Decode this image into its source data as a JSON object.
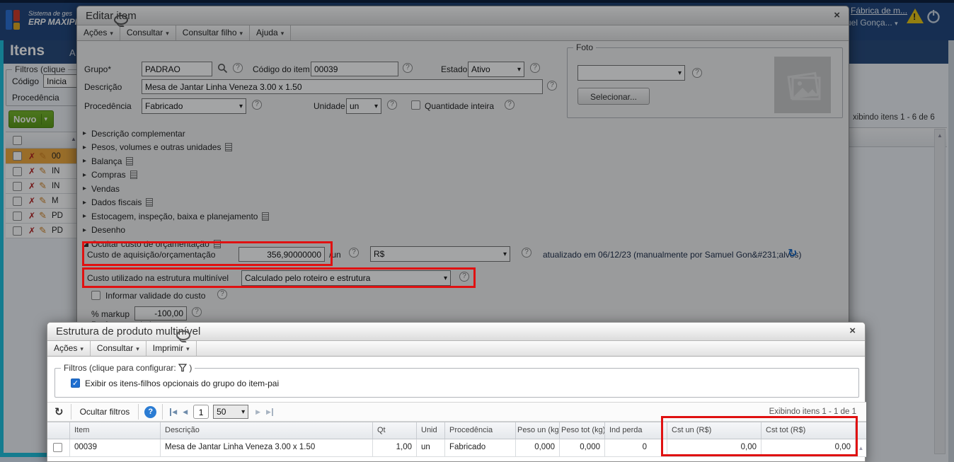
{
  "colors": {
    "highlight_red": "#e01111",
    "topbar_navy": "#20457c",
    "teal_border": "#1ec0dc",
    "novo_green": "#63a812",
    "selected_row_orange": "#efa93d",
    "accent_blue": "#2b7cd3"
  },
  "icons": {
    "caret_glyph": "▾",
    "collapsed_glyph": "▸",
    "close_glyph": "×",
    "refresh_glyph": "↻",
    "check_glyph": "✓",
    "delete_glyph": "✗",
    "edit_glyph": "✎",
    "sort_asc_glyph": "▲",
    "scroll_up_glyph": "▲",
    "prev_glyph": "◀",
    "next_glyph": "▶",
    "warning_glyph": "!"
  },
  "topbar": {
    "logo_line1": "Sistema de ges",
    "logo_line2": "ERP MAXIPR",
    "factory_link": "Fábrica de m...",
    "user": "uel Gonça..."
  },
  "bg_page": {
    "title": "Itens",
    "title_fragment": "A",
    "filters_legend": "Filtros (clique",
    "codigo_label": "Código",
    "codigo_value": "Inicia",
    "procedencia_label": "Procedência",
    "novo_label": "Novo",
    "showing_fragment": "xibindo itens 1 - 6 de 6",
    "rows": [
      "00",
      "IN",
      "IN",
      "M",
      "PD",
      "PD"
    ]
  },
  "edit_modal": {
    "title": "Editar item",
    "menu": {
      "acoes": "Ações",
      "consultar": "Consultar",
      "consultar_filho": "Consultar filho",
      "ajuda": "Ajuda"
    },
    "fields": {
      "grupo_label": "Grupo*",
      "grupo_value": "PADRAO",
      "codigo_label": "Código do item",
      "codigo_value": "00039",
      "estado_label": "Estado",
      "estado_value": "Ativo",
      "descricao_label": "Descrição",
      "descricao_value": "Mesa de Jantar Linha Veneza 3.00 x 1.50",
      "procedencia_label": "Procedência",
      "procedencia_value": "Fabricado",
      "unidade_label": "Unidade",
      "unidade_value": "un",
      "qtd_inteira_label": "Quantidade inteira"
    },
    "foto": {
      "legend": "Foto",
      "selecionar": "Selecionar..."
    },
    "sections": [
      "Descrição complementar",
      "Pesos, volumes e outras unidades",
      "Balança",
      "Compras",
      "Vendas",
      "Dados fiscais",
      "Estocagem, inspeção, baixa e planejamento",
      "Desenho",
      "Ocultar custo de orçamentação"
    ],
    "partial_section": "Parâmetros do item",
    "cost": {
      "custo_label": "Custo de aquisição/orçamentação",
      "custo_value": "356,90000000",
      "custo_unit": "/un",
      "moeda_value": "R$",
      "updated_text": "atualizado em 06/12/23 (manualmente por Samuel Gon&#231;alves)",
      "custo_estrutura_label": "Custo utilizado na estrutura multinível",
      "custo_estrutura_value": "Calculado pelo roteiro e estrutura",
      "validade_label": "Informar validade do custo",
      "markup_label": "% markup",
      "markup_value": "-100,00"
    }
  },
  "structure_modal": {
    "title": "Estrutura de produto multinível",
    "menu": {
      "acoes": "Ações",
      "consultar": "Consultar",
      "imprimir": "Imprimir"
    },
    "filters": {
      "legend_prefix": "Filtros (clique para configurar:",
      "legend_suffix": ")",
      "checkbox_label": "Exibir os itens-filhos opcionais do grupo do item-pai"
    },
    "toolbar": {
      "ocultar_filtros": "Ocultar filtros",
      "page": "1",
      "page_size": "50",
      "showing": "Exibindo itens 1 - 1 de 1"
    },
    "table": {
      "headers": [
        "Item",
        "Descrição",
        "Qt",
        "Unid",
        "Procedência",
        "Peso un (kg)",
        "Peso tot (kg)",
        "Ind perda",
        "Cst un (R$)",
        "Cst tot (R$)"
      ],
      "rows": [
        [
          "00039",
          "Mesa de Jantar Linha Veneza 3.00 x 1.50",
          "1,00",
          "un",
          "Fabricado",
          "0,000",
          "0,000",
          "0",
          "0,00",
          "0,00"
        ]
      ]
    }
  }
}
